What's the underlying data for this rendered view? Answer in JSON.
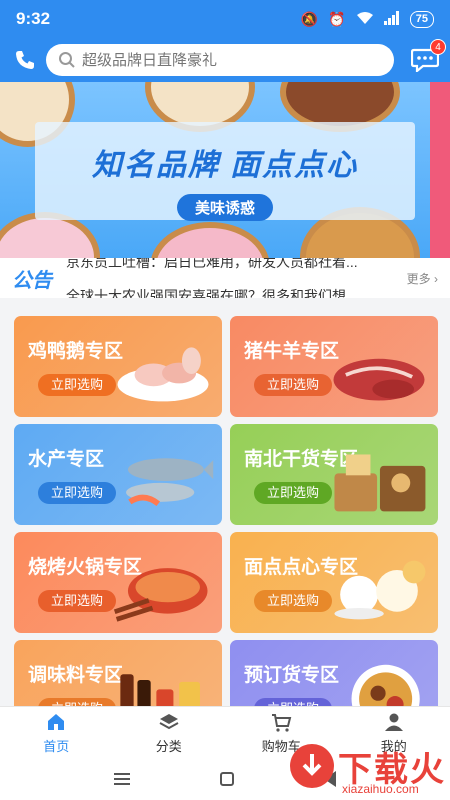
{
  "status_bar": {
    "time": "9:32",
    "battery": "75"
  },
  "header": {
    "search_placeholder": "超级品牌日直降豪礼",
    "message_badge": "4"
  },
  "banner": {
    "title": "知名品牌 面点点心",
    "tag": "美味诱惑"
  },
  "notice": {
    "label": "公告",
    "line1": "京东员工吐槽：启日已难用，研发人员都社着...",
    "line2": "全球十大农业强国安喜强在哪？很多和我们想",
    "more": "更多"
  },
  "categories": [
    {
      "title": "鸡鸭鹅专区",
      "button": "立即选购",
      "icon": "poultry-meat-icon",
      "bg": "#f99a4e",
      "btn_color": "#ef6f22"
    },
    {
      "title": "猪牛羊专区",
      "button": "立即选购",
      "icon": "beef-steak-icon",
      "bg": "#f88a63",
      "btn_color": "#e86332"
    },
    {
      "title": "水产专区",
      "button": "立即选购",
      "icon": "fish-seafood-icon",
      "bg": "#5eaaf3",
      "btn_color": "#2d7fdc"
    },
    {
      "title": "南北干货专区",
      "button": "立即选购",
      "icon": "dried-goods-icon",
      "bg": "#96cf57",
      "btn_color": "#5fa824"
    },
    {
      "title": "烧烤火锅专区",
      "button": "立即选购",
      "icon": "hotpot-bbq-icon",
      "bg": "#fc8a5c",
      "btn_color": "#e85f2c"
    },
    {
      "title": "面点点心专区",
      "button": "立即选购",
      "icon": "dim-sum-icon",
      "bg": "#f9b14f",
      "btn_color": "#e8892a"
    },
    {
      "title": "调味料专区",
      "button": "立即选购",
      "icon": "condiment-bottles-icon",
      "bg": "#f9a45c",
      "btn_color": "#e87a2a"
    },
    {
      "title": "预订货专区",
      "button": "立即选购",
      "icon": "food-platter-icon",
      "bg": "#8f8ff0",
      "btn_color": "#6463d8"
    }
  ],
  "tabbar": [
    {
      "label": "首页",
      "icon": "home-icon",
      "active": true
    },
    {
      "label": "分类",
      "icon": "layers-icon",
      "active": false
    },
    {
      "label": "购物车",
      "icon": "cart-icon",
      "active": false
    },
    {
      "label": "我的",
      "icon": "user-icon",
      "active": false
    }
  ],
  "watermark": {
    "text": "下载火",
    "url": "xiazaihuo.com"
  },
  "colors": {
    "primary": "#2f8cf0",
    "badge": "#ff3b30",
    "watermark": "#e8423a"
  }
}
